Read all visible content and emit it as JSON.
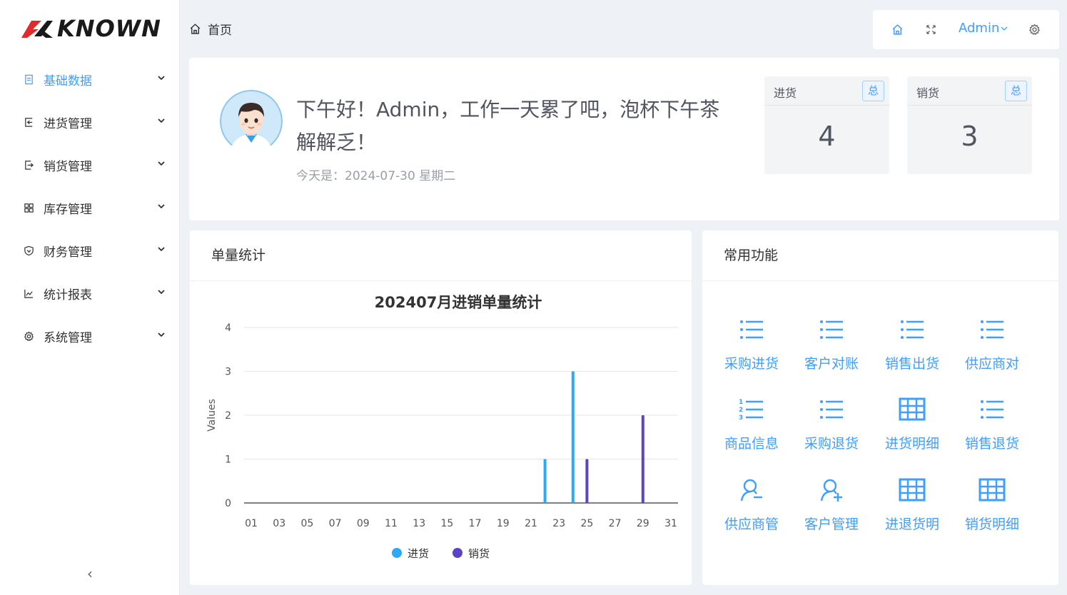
{
  "app": {
    "logo_text": "KNOWN"
  },
  "sidebar": {
    "items": [
      {
        "label": "基础数据",
        "icon": "document-icon",
        "active": true
      },
      {
        "label": "进货管理",
        "icon": "import-icon",
        "active": false
      },
      {
        "label": "销货管理",
        "icon": "export-icon",
        "active": false
      },
      {
        "label": "库存管理",
        "icon": "grid-icon",
        "active": false
      },
      {
        "label": "财务管理",
        "icon": "shield-icon",
        "active": false
      },
      {
        "label": "统计报表",
        "icon": "line-chart-icon",
        "active": false
      },
      {
        "label": "系统管理",
        "icon": "gear-icon",
        "active": false
      }
    ],
    "collapse_label": "‹"
  },
  "header": {
    "breadcrumb": "首页",
    "user": "Admin",
    "accent": "#409eff"
  },
  "welcome": {
    "greeting": "下午好！Admin，工作一天累了吧，泡杯下午茶解解乏！",
    "date_text": "今天是：2024-07-30 星期二",
    "stats": [
      {
        "title": "进货",
        "badge": "总",
        "value": "4"
      },
      {
        "title": "销货",
        "badge": "总",
        "value": "3"
      }
    ]
  },
  "chart_card": {
    "title": "单量统计"
  },
  "functions_card": {
    "title": "常用功能",
    "items": [
      {
        "label": "采购进货",
        "icon": "list-icon"
      },
      {
        "label": "客户对账",
        "icon": "list-icon"
      },
      {
        "label": "销售出货",
        "icon": "list-icon"
      },
      {
        "label": "供应商对",
        "icon": "list-icon"
      },
      {
        "label": "商品信息",
        "icon": "ordered-list-icon"
      },
      {
        "label": "采购退货",
        "icon": "list-icon"
      },
      {
        "label": "进货明细",
        "icon": "table-icon"
      },
      {
        "label": "销售退货",
        "icon": "list-icon"
      },
      {
        "label": "供应商管",
        "icon": "user-minus-icon"
      },
      {
        "label": "客户管理",
        "icon": "user-plus-icon"
      },
      {
        "label": "进退货明",
        "icon": "table-icon"
      },
      {
        "label": "销货明细",
        "icon": "table-icon"
      }
    ]
  },
  "chart_data": {
    "type": "bar",
    "title": "202407月进销单量统计",
    "xlabel": "",
    "ylabel": "Values",
    "ylim": [
      0,
      4
    ],
    "yticks": [
      "0",
      "1",
      "2",
      "3",
      "4"
    ],
    "x_tick_labels": [
      "01",
      "03",
      "05",
      "07",
      "09",
      "11",
      "13",
      "15",
      "17",
      "19",
      "21",
      "23",
      "25",
      "27",
      "29",
      "31"
    ],
    "categories": [
      "01",
      "02",
      "03",
      "04",
      "05",
      "06",
      "07",
      "08",
      "09",
      "10",
      "11",
      "12",
      "13",
      "14",
      "15",
      "16",
      "17",
      "18",
      "19",
      "20",
      "21",
      "22",
      "23",
      "24",
      "25",
      "26",
      "27",
      "28",
      "29",
      "30",
      "31"
    ],
    "series": [
      {
        "name": "进货",
        "color": "#2ea9f5",
        "values": [
          0,
          0,
          0,
          0,
          0,
          0,
          0,
          0,
          0,
          0,
          0,
          0,
          0,
          0,
          0,
          0,
          0,
          0,
          0,
          0,
          0,
          1,
          0,
          3,
          0,
          0,
          0,
          0,
          0,
          0,
          0
        ]
      },
      {
        "name": "销货",
        "color": "#5b45c5",
        "values": [
          0,
          0,
          0,
          0,
          0,
          0,
          0,
          0,
          0,
          0,
          0,
          0,
          0,
          0,
          0,
          0,
          0,
          0,
          0,
          0,
          0,
          0,
          0,
          0,
          1,
          0,
          0,
          0,
          2,
          0,
          0
        ]
      }
    ],
    "grid": true,
    "legend_position": "bottom"
  }
}
